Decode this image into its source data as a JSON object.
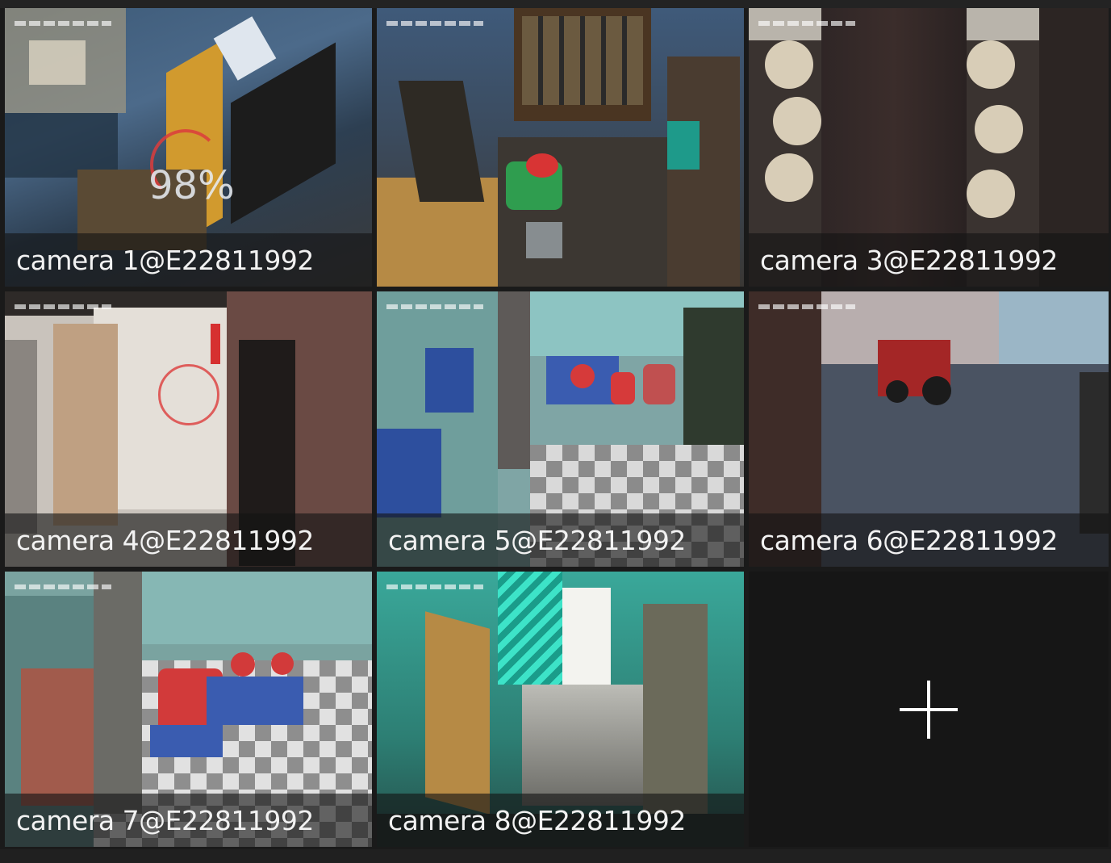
{
  "cameras": [
    {
      "label": "camera 1@E22811992",
      "status": "loading",
      "progress_text": "98%",
      "progress_percent": 98,
      "selected": false
    },
    {
      "label": "",
      "status": "live",
      "selected": true
    },
    {
      "label": "camera 3@E22811992",
      "status": "live",
      "selected": false
    },
    {
      "label": "camera 4@E22811992",
      "status": "loading",
      "selected": false
    },
    {
      "label": "camera 5@E22811992",
      "status": "live",
      "selected": false
    },
    {
      "label": "camera 6@E22811992",
      "status": "live",
      "selected": false
    },
    {
      "label": "camera 7@E22811992",
      "status": "live",
      "selected": false
    },
    {
      "label": "camera 8@E22811992",
      "status": "live",
      "selected": false
    }
  ],
  "add_tile": {
    "icon": "plus-icon"
  },
  "colors": {
    "background": "#1a1a1a",
    "selected_outline": "#d9696b",
    "loading_spinner": "#dc3c3c",
    "label_text": "#f2f2f2"
  }
}
